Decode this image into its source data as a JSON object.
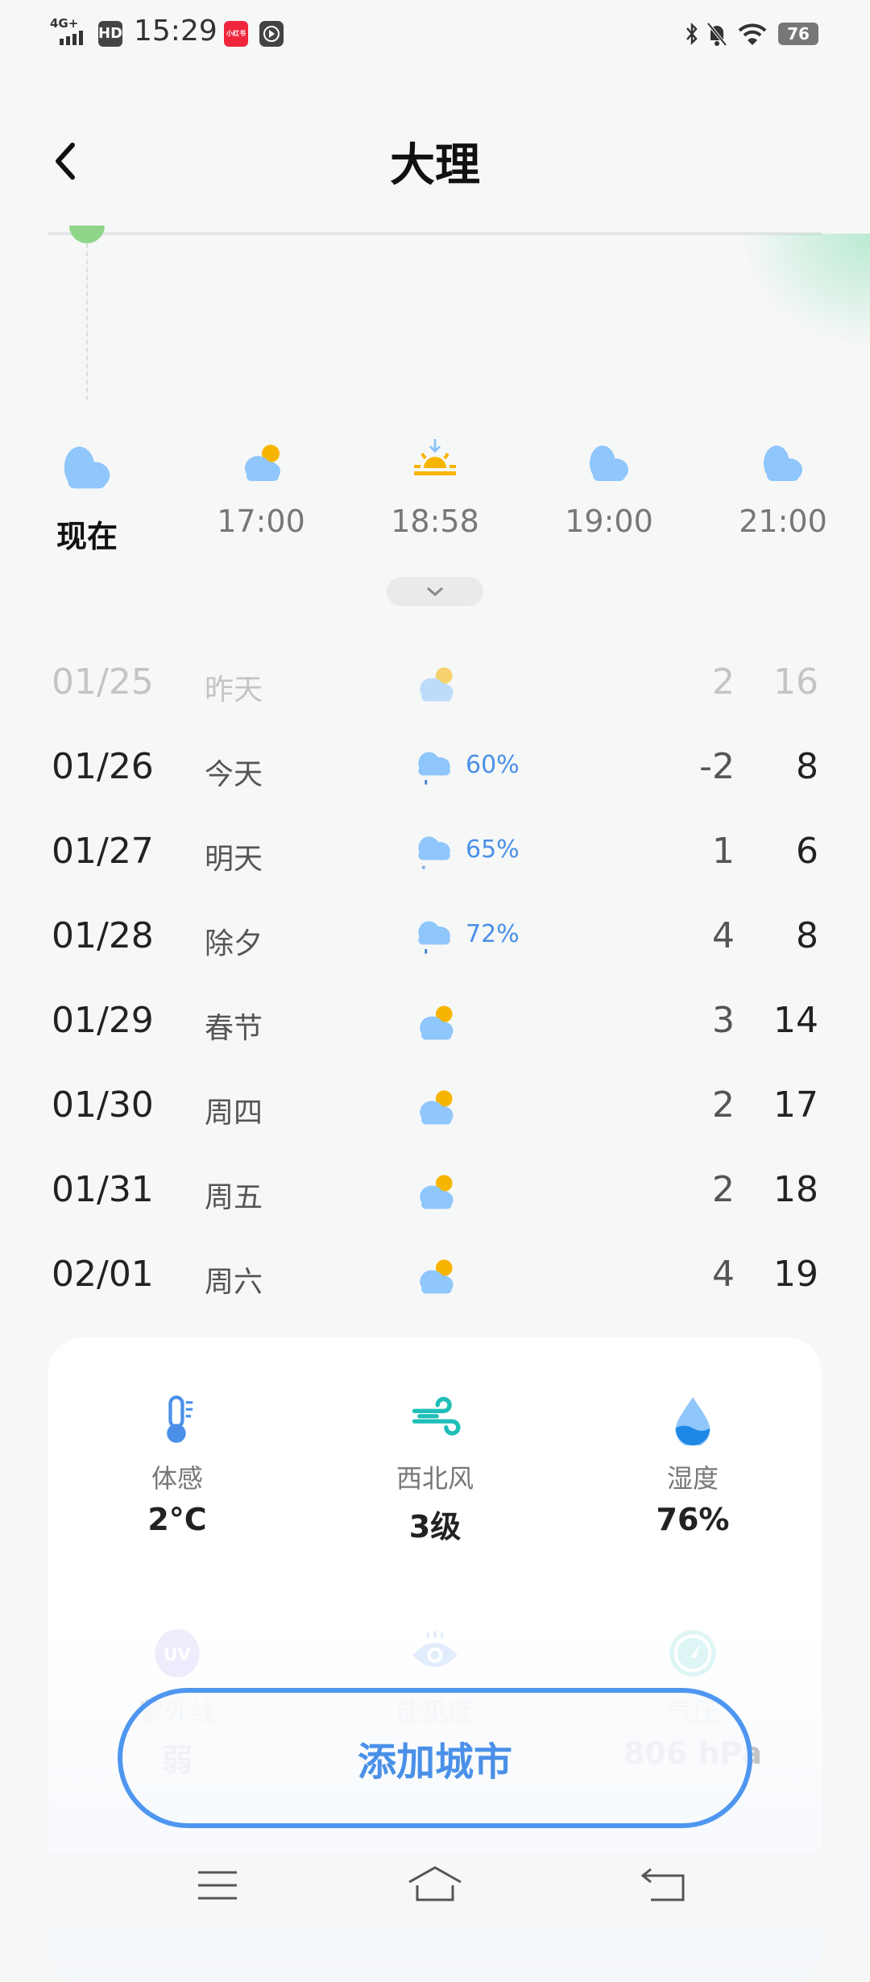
{
  "status_bar": {
    "network": "4G+",
    "hd": "HD",
    "time": "15:29",
    "app_badge": "小红书",
    "battery": "76"
  },
  "header": {
    "title": "大理",
    "back_icon": "chevron-left-icon"
  },
  "hourly": [
    {
      "label": "现在",
      "icon": "cloudy"
    },
    {
      "label": "17:00",
      "icon": "partly-cloudy"
    },
    {
      "label": "18:58",
      "icon": "sunset"
    },
    {
      "label": "19:00",
      "icon": "cloudy"
    },
    {
      "label": "21:00",
      "icon": "cloudy"
    }
  ],
  "daily": [
    {
      "date": "01/25",
      "day": "昨天",
      "icon": "partly-cloudy",
      "pct": "",
      "lo": "2",
      "hi": "16",
      "past": true
    },
    {
      "date": "01/26",
      "day": "今天",
      "icon": "rain",
      "pct": "60%",
      "lo": "-2",
      "hi": "8"
    },
    {
      "date": "01/27",
      "day": "明天",
      "icon": "sleet",
      "pct": "65%",
      "lo": "1",
      "hi": "6"
    },
    {
      "date": "01/28",
      "day": "除夕",
      "icon": "rain",
      "pct": "72%",
      "lo": "4",
      "hi": "8"
    },
    {
      "date": "01/29",
      "day": "春节",
      "icon": "partly-cloudy",
      "pct": "",
      "lo": "3",
      "hi": "14"
    },
    {
      "date": "01/30",
      "day": "周四",
      "icon": "partly-cloudy",
      "pct": "",
      "lo": "2",
      "hi": "17"
    },
    {
      "date": "01/31",
      "day": "周五",
      "icon": "partly-cloudy",
      "pct": "",
      "lo": "2",
      "hi": "18"
    },
    {
      "date": "02/01",
      "day": "周六",
      "icon": "partly-cloudy",
      "pct": "",
      "lo": "4",
      "hi": "19"
    }
  ],
  "details": [
    {
      "label": "体感",
      "value": "2°C",
      "icon": "thermometer-icon"
    },
    {
      "label": "西北风",
      "value": "3级",
      "icon": "wind-icon"
    },
    {
      "label": "湿度",
      "value": "76%",
      "icon": "humidity-icon"
    },
    {
      "label": "紫外线",
      "value": "弱",
      "icon": "uv-icon"
    },
    {
      "label": "能见度",
      "value": "",
      "icon": "eye-icon"
    },
    {
      "label": "气压",
      "value": "806 hPa",
      "icon": "pressure-icon"
    }
  ],
  "add_city_label": "添加城市",
  "colors": {
    "accent": "#4f96f0",
    "cloud": "#8fc6fb",
    "sun": "#f7b500",
    "wind": "#1fbfb8"
  }
}
